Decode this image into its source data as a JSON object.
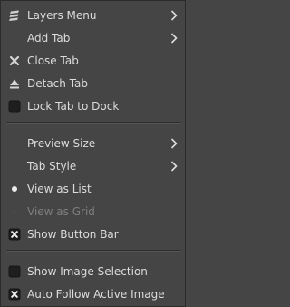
{
  "menu": {
    "items": [
      {
        "label": "Layers Menu",
        "icon": "layers-menu-icon",
        "submenu": true
      },
      {
        "label": "Add Tab",
        "icon": "",
        "submenu": true
      },
      {
        "label": "Close Tab",
        "icon": "close-icon",
        "submenu": false
      },
      {
        "label": "Detach Tab",
        "icon": "eject-icon",
        "submenu": false
      },
      {
        "label": "Lock Tab to Dock",
        "icon": "checkbox-unchecked-icon",
        "checked": false
      },
      {
        "label": "Preview Size",
        "icon": "",
        "submenu": true
      },
      {
        "label": "Tab Style",
        "icon": "",
        "submenu": true
      },
      {
        "label": "View as List",
        "icon": "radio-selected-icon",
        "selected": true
      },
      {
        "label": "View as Grid",
        "icon": "radio-unselected-icon",
        "selected": false,
        "disabled": true
      },
      {
        "label": "Show Button Bar",
        "icon": "checkbox-checked-icon",
        "checked": true
      },
      {
        "label": "Show Image Selection",
        "icon": "checkbox-unchecked-icon",
        "checked": false
      },
      {
        "label": "Auto Follow Active Image",
        "icon": "checkbox-checked-icon",
        "checked": true
      }
    ]
  },
  "colors": {
    "background": "#454545",
    "text": "#dcdcdc",
    "disabled_text": "#7e7e7e",
    "separator": "#2e2e2e"
  }
}
